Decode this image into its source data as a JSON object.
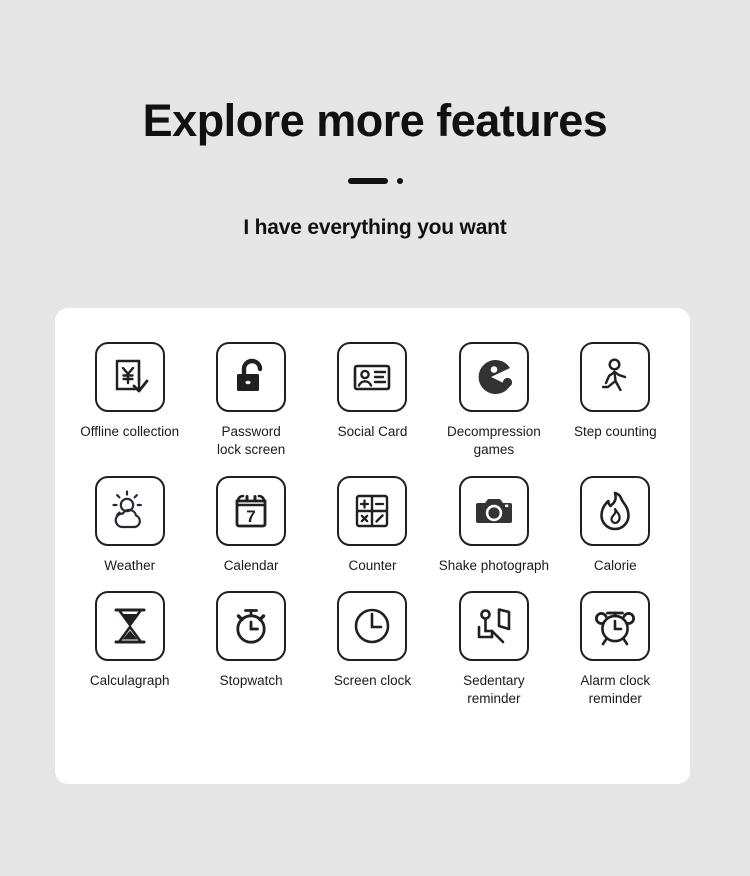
{
  "header": {
    "title": "Explore more features",
    "subtitle": "I have everything you want",
    "divider_icon": "dash-dot-divider"
  },
  "theme": {
    "page_background": "#e6e6e6",
    "card_background": "#ffffff",
    "text_color": "#1a1a1a",
    "icon_stroke": "#231f20"
  },
  "features": [
    {
      "label": "Offline collection",
      "icon": "yen-document-check-icon"
    },
    {
      "label": "Password\nlock screen",
      "icon": "open-padlock-icon"
    },
    {
      "label": "Social Card",
      "icon": "id-card-icon"
    },
    {
      "label": "Decompression\ngames",
      "icon": "pacman-game-icon"
    },
    {
      "label": "Step counting",
      "icon": "walking-person-icon"
    },
    {
      "label": "Weather",
      "icon": "sun-cloud-icon"
    },
    {
      "label": "Calendar",
      "icon": "calendar-7-icon"
    },
    {
      "label": "Counter",
      "icon": "calculator-grid-icon"
    },
    {
      "label": "Shake photograph",
      "icon": "camera-icon"
    },
    {
      "label": "Calorie",
      "icon": "flame-icon"
    },
    {
      "label": "Calculagraph",
      "icon": "hourglass-icon"
    },
    {
      "label": "Stopwatch",
      "icon": "stopwatch-icon"
    },
    {
      "label": "Screen clock",
      "icon": "clock-icon"
    },
    {
      "label": "Sedentary\nreminder",
      "icon": "seated-person-screen-icon"
    },
    {
      "label": "Alarm clock\nreminder",
      "icon": "alarm-clock-icon"
    }
  ],
  "calendar_day": "7"
}
